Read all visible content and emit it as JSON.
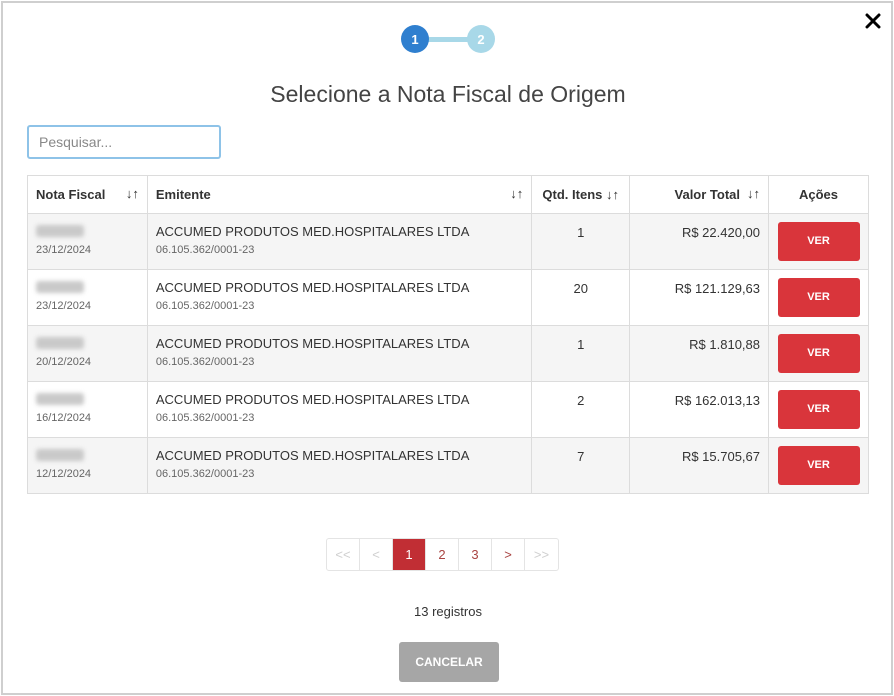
{
  "stepper": {
    "steps": [
      "1",
      "2"
    ],
    "active": 1
  },
  "title": "Selecione a Nota Fiscal de Origem",
  "search": {
    "placeholder": "Pesquisar...",
    "value": ""
  },
  "table": {
    "headers": {
      "nota_fiscal": "Nota Fiscal",
      "emitente": "Emitente",
      "qtd_itens": "Qtd. Itens",
      "valor_total": "Valor Total",
      "acoes": "Ações"
    },
    "rows": [
      {
        "nf_number": "6448812",
        "date": "23/12/2024",
        "emitente": "ACCUMED PRODUTOS MED.HOSPITALARES LTDA",
        "cnpj": "06.105.362/0001-23",
        "qtd": "1",
        "valor": "R$ 22.420,00",
        "action": "VER"
      },
      {
        "nf_number": "6448655",
        "date": "23/12/2024",
        "emitente": "ACCUMED PRODUTOS MED.HOSPITALARES LTDA",
        "cnpj": "06.105.362/0001-23",
        "qtd": "20",
        "valor": "R$ 121.129,63",
        "action": "VER"
      },
      {
        "nf_number": "6444178",
        "date": "20/12/2024",
        "emitente": "ACCUMED PRODUTOS MED.HOSPITALARES LTDA",
        "cnpj": "06.105.362/0001-23",
        "qtd": "1",
        "valor": "R$ 1.810,88",
        "action": "VER"
      },
      {
        "nf_number": "6432142",
        "date": "16/12/2024",
        "emitente": "ACCUMED PRODUTOS MED.HOSPITALARES LTDA",
        "cnpj": "06.105.362/0001-23",
        "qtd": "2",
        "valor": "R$ 162.013,13",
        "action": "VER"
      },
      {
        "nf_number": "6428411",
        "date": "12/12/2024",
        "emitente": "ACCUMED PRODUTOS MED.HOSPITALARES LTDA",
        "cnpj": "06.105.362/0001-23",
        "qtd": "7",
        "valor": "R$ 15.705,67",
        "action": "VER"
      }
    ]
  },
  "pagination": {
    "first": "<<",
    "prev": "<",
    "pages": [
      "1",
      "2",
      "3"
    ],
    "current": "1",
    "next": ">",
    "last": ">>"
  },
  "records": "13 registros",
  "cancel_label": "CANCELAR",
  "colors": {
    "primary": "#2f7fcf",
    "danger": "#d9353b",
    "page_active": "#c12e34",
    "muted": "#a6a6a6"
  }
}
